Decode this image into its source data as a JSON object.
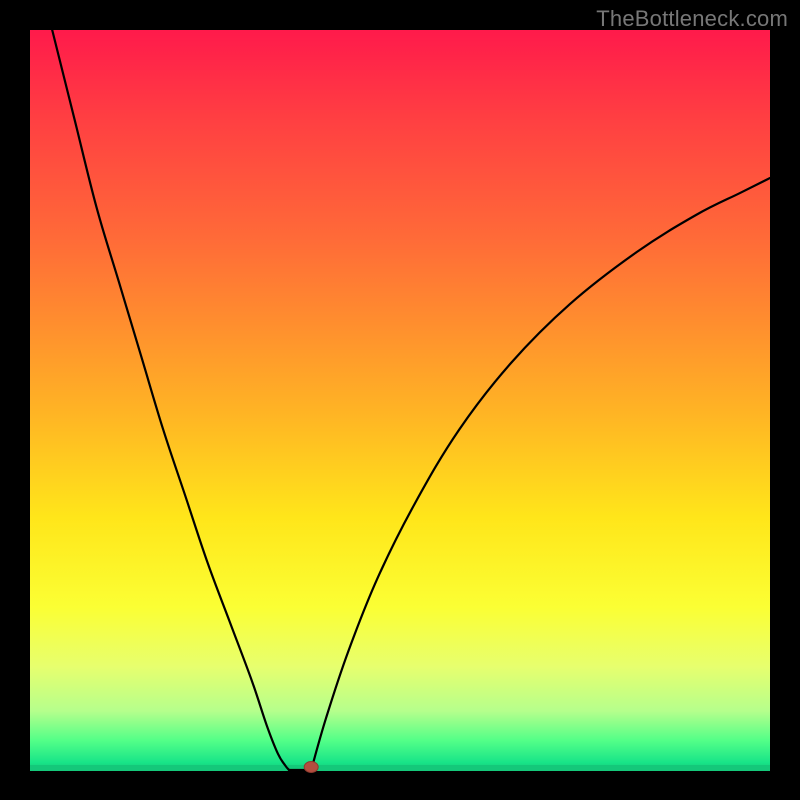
{
  "watermark": "TheBottleneck.com",
  "chart_data": {
    "type": "line",
    "title": "",
    "xlabel": "",
    "ylabel": "",
    "xlim": [
      0,
      100
    ],
    "ylim": [
      0,
      100
    ],
    "grid": false,
    "legend": false,
    "background_gradient": {
      "stops": [
        {
          "pos": 0.0,
          "color": "#ff1a4b"
        },
        {
          "pos": 0.5,
          "color": "#ffb524"
        },
        {
          "pos": 0.8,
          "color": "#fbff34"
        },
        {
          "pos": 1.0,
          "color": "#14c87a"
        }
      ]
    },
    "series": [
      {
        "name": "left-branch",
        "x": [
          3,
          6,
          9,
          12,
          15,
          18,
          21,
          24,
          27,
          30,
          32,
          33.5,
          34.5,
          35
        ],
        "values": [
          100,
          88,
          76,
          66,
          56,
          46,
          37,
          28,
          20,
          12,
          6,
          2.2,
          0.6,
          0
        ]
      },
      {
        "name": "right-branch",
        "x": [
          38,
          40,
          43,
          47,
          52,
          58,
          65,
          73,
          82,
          90,
          96,
          100
        ],
        "values": [
          0,
          7,
          16,
          26,
          36,
          46,
          55,
          63,
          70,
          75,
          78,
          80
        ]
      }
    ],
    "notch": {
      "x_start": 35,
      "x_end": 38,
      "y": 0
    },
    "marker": {
      "x": 38,
      "y": 0,
      "color": "#b44d3f"
    }
  }
}
